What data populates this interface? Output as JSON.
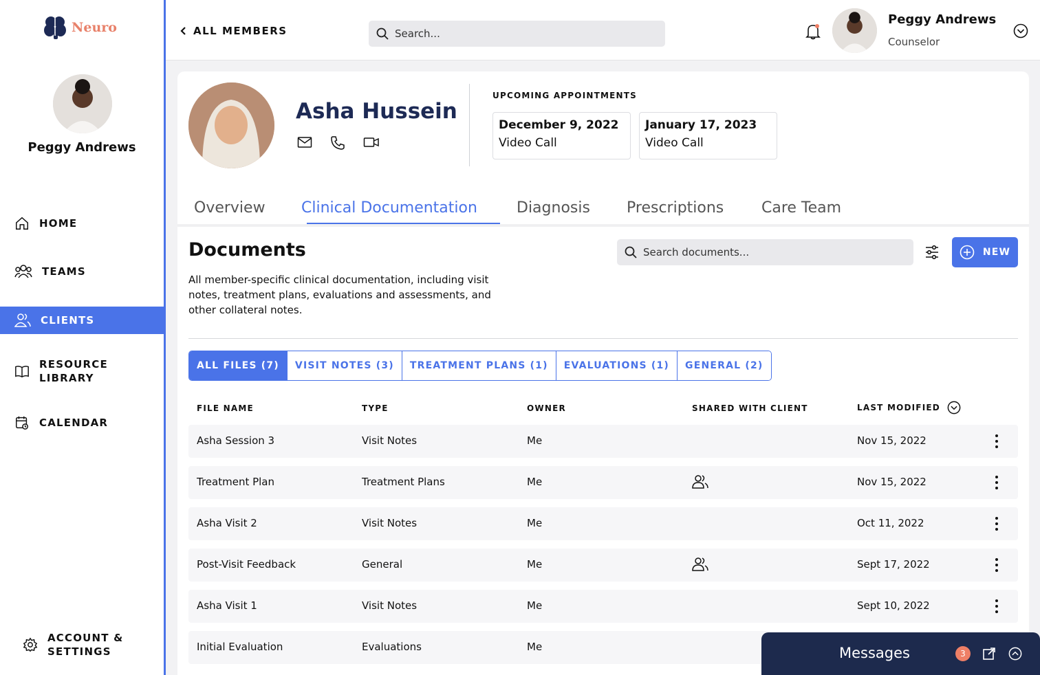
{
  "brand": {
    "name": "Neuro",
    "color": "#e8816a"
  },
  "accent_color": "#4a73e8",
  "sidebar": {
    "user_name": "Peggy Andrews",
    "items": [
      {
        "label": "HOME",
        "icon": "home-icon"
      },
      {
        "label": "TEAMS",
        "icon": "teams-icon"
      },
      {
        "label": "CLIENTS",
        "icon": "clients-icon",
        "active": true
      },
      {
        "label_line1": "RESOURCE",
        "label_line2": "LIBRARY",
        "icon": "book-icon"
      },
      {
        "label": "CALENDAR",
        "icon": "calendar-icon"
      },
      {
        "label_line1": "ACCOUNT &",
        "label_line2": "SETTINGS",
        "icon": "gear-icon"
      }
    ]
  },
  "topbar": {
    "back_label": "ALL MEMBERS",
    "search_placeholder": "Search...",
    "user_name": "Peggy Andrews",
    "user_role": "Counselor"
  },
  "client": {
    "name": "Asha Hussein",
    "appointments_title": "UPCOMING APPOINTMENTS",
    "appointments": [
      {
        "date": "December 9, 2022",
        "type": "Video Call"
      },
      {
        "date": "January 17, 2023",
        "type": "Video Call"
      }
    ]
  },
  "tabs": [
    {
      "label": "Overview"
    },
    {
      "label": "Clinical Documentation",
      "active": true
    },
    {
      "label": "Diagnosis"
    },
    {
      "label": "Prescriptions"
    },
    {
      "label": "Care Team"
    }
  ],
  "documents": {
    "title": "Documents",
    "description": "All member-specific clinical documentation, including visit notes, treatment plans, evaluations and assessments, and other collateral notes.",
    "search_placeholder": "Search documents...",
    "new_label": "NEW",
    "filters": [
      {
        "label": "ALL FILES (7)",
        "active": true
      },
      {
        "label": "VISIT NOTES (3)"
      },
      {
        "label": "TREATMENT PLANS (1)"
      },
      {
        "label": "EVALUATIONS (1)"
      },
      {
        "label": "GENERAL (2)"
      }
    ],
    "columns": [
      "FILE NAME",
      "TYPE",
      "OWNER",
      "SHARED WITH CLIENT",
      "LAST MODIFIED"
    ],
    "rows": [
      {
        "name": "Asha Session 3",
        "type": "Visit Notes",
        "owner": "Me",
        "shared": false,
        "modified": "Nov 15, 2022"
      },
      {
        "name": "Treatment Plan",
        "type": "Treatment Plans",
        "owner": "Me",
        "shared": true,
        "modified": "Nov 15, 2022"
      },
      {
        "name": "Asha Visit 2",
        "type": "Visit Notes",
        "owner": "Me",
        "shared": false,
        "modified": "Oct 11, 2022"
      },
      {
        "name": "Post-Visit Feedback",
        "type": "General",
        "owner": "Me",
        "shared": true,
        "modified": "Sept 17, 2022"
      },
      {
        "name": "Asha Visit 1",
        "type": "Visit Notes",
        "owner": "Me",
        "shared": false,
        "modified": "Sept 10, 2022"
      },
      {
        "name": "Initial Evaluation",
        "type": "Evaluations",
        "owner": "Me",
        "shared": false,
        "modified": ""
      }
    ]
  },
  "messages": {
    "title": "Messages",
    "unread_count": "3",
    "badge_color": "#ee7f66"
  }
}
